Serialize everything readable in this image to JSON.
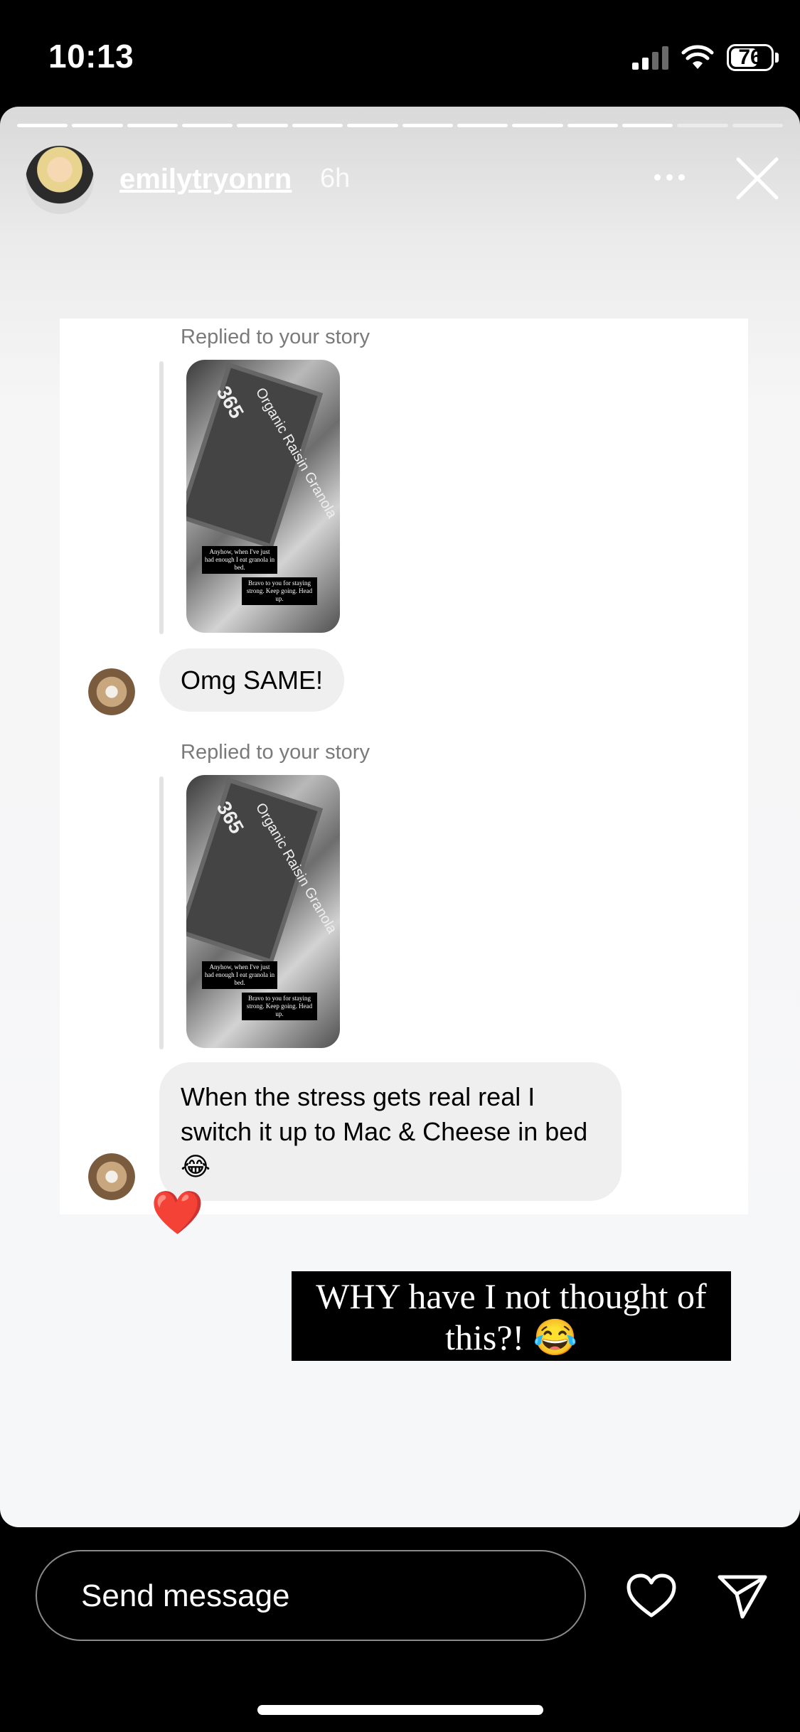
{
  "status_bar": {
    "time": "10:13",
    "battery": "76"
  },
  "story": {
    "username": "emilytryonrn",
    "age": "6h",
    "progress_segments_total": 14,
    "progress_segments_viewed": 12
  },
  "thread": {
    "replies": [
      {
        "replied_label": "Replied to your story",
        "story_thumb": {
          "brand": "365",
          "product": "Organic Raisin Granola",
          "caption_1": "Anyhow, when I've just had enough I eat granola in bed.",
          "caption_2": "Bravo to you for staying strong. Keep going. Head up."
        },
        "message": "Omg SAME!"
      },
      {
        "replied_label": "Replied to your story",
        "story_thumb": {
          "brand": "365",
          "product": "Organic Raisin Granola",
          "caption_1": "Anyhow, when I've just had enough I eat granola in bed.",
          "caption_2": "Bravo to you for staying strong. Keep going. Head up."
        },
        "message": "When the stress gets real real I switch it up to Mac & Cheese in bed 😂",
        "reaction": "❤️"
      }
    ]
  },
  "caption": "WHY have I not thought of this?! 😂",
  "bottom_bar": {
    "send_placeholder": "Send message"
  },
  "colors": {
    "background": "#000000",
    "bubble": "#efefef",
    "heart": "#e0141e"
  },
  "icons": [
    "signal-icon",
    "wifi-icon",
    "battery-icon",
    "more-icon",
    "close-icon",
    "heart-icon",
    "send-icon"
  ]
}
